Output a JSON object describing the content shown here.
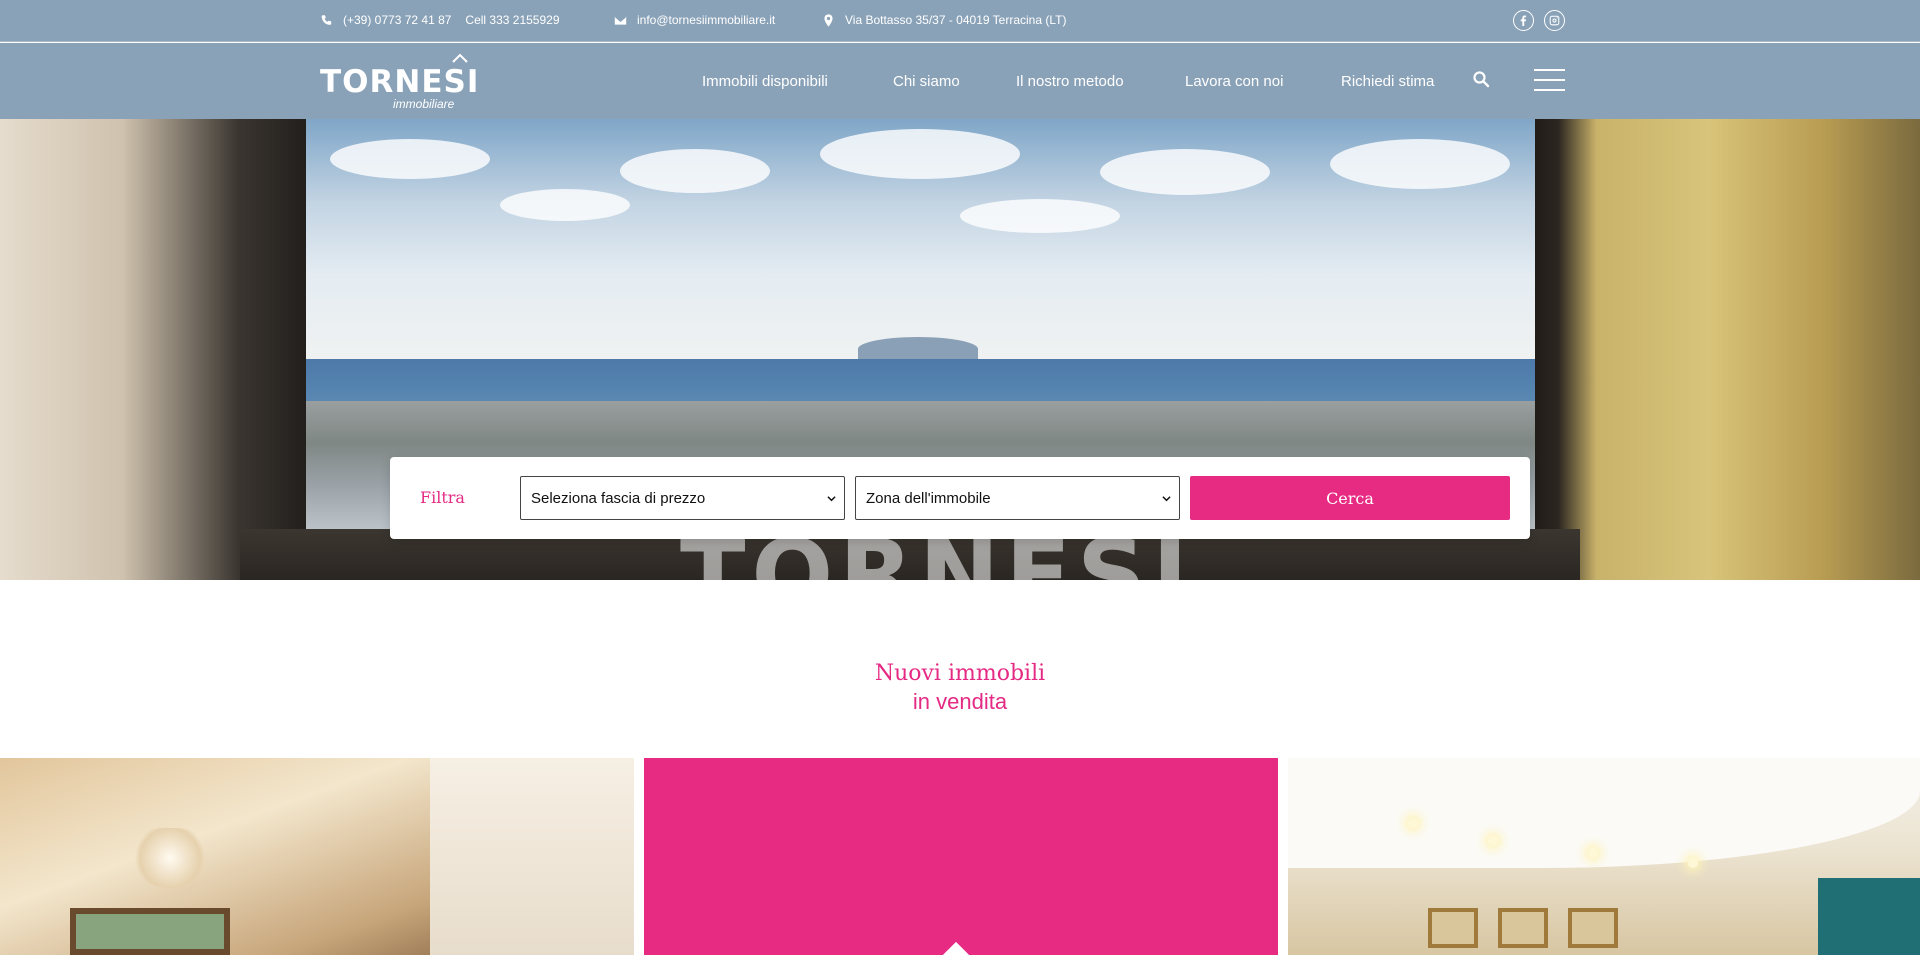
{
  "topbar": {
    "phone": "(+39) 0773 72 41 87",
    "cell": "Cell 333 2155929",
    "email": "info@tornesiimmobiliare.it",
    "address": "Via Bottasso 35/37 - 04019 Terracina (LT)",
    "social": [
      "facebook-icon",
      "instagram-icon"
    ]
  },
  "logo": {
    "name": "TORNESI",
    "tagline": "immobiliare"
  },
  "nav": {
    "items": [
      "Immobili disponibili",
      "Chi siamo",
      "Il nostro metodo",
      "Lavora con noi",
      "Richiedi stima"
    ],
    "icons": [
      "search-icon",
      "hamburger-menu-icon"
    ]
  },
  "hero": {
    "watermark": "TORNESI"
  },
  "filter": {
    "label": "Filtra",
    "price_select": "Seleziona fascia di prezzo",
    "zone_select": "Zona dell'immobile",
    "button": "Cerca"
  },
  "listings": {
    "title_line1": "Nuovi immobili",
    "title_line2": "in vendita"
  },
  "colors": {
    "header_bg": "#8aa2b8",
    "accent": "#e72a82"
  }
}
